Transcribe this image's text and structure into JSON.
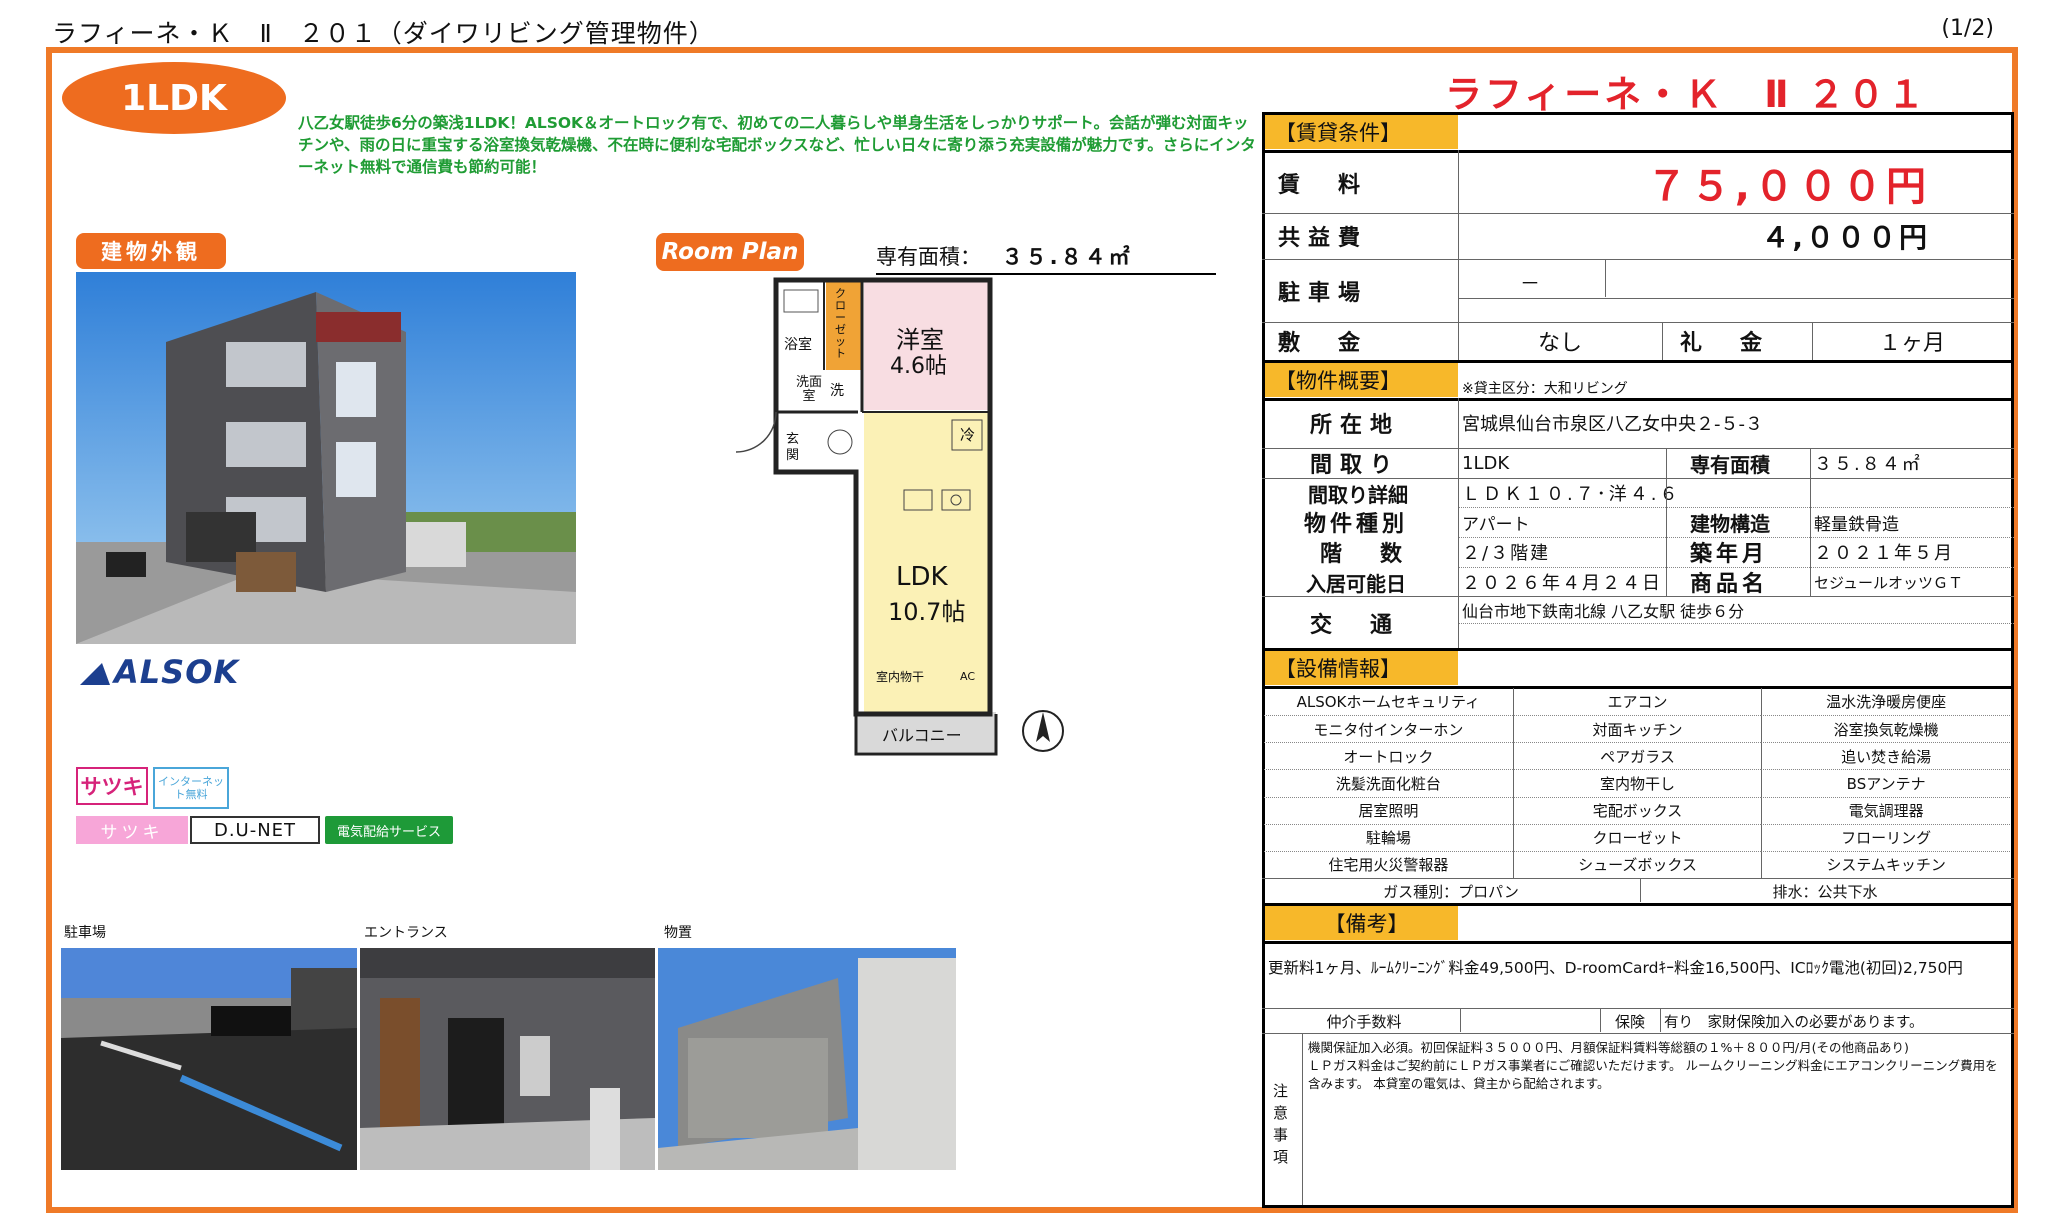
{
  "header": {
    "title": "ラフィーネ・Ｋ　Ⅱ　２０１（ダイワリビング管理物件）",
    "page": "(1/2)"
  },
  "badge_type": "1LDK",
  "description": "八乙女駅徒歩6分の築浅1LDK！ALSOK＆オートロック有で、初めての二人暮らしや単身生活をしっかりサポート。会話が弾む対面キッチンや、雨の日に重宝する浴室換気乾燥機、不在時に便利な宅配ボックスなど、忙しい日々に寄り添う充実設備が魅力です。さらにインターネット無料で通信費も節約可能！",
  "left": {
    "exterior_label": "建物外観",
    "plan_label": "Room Plan",
    "area_label": "専有面積：",
    "area_value": "３５.８４㎡",
    "alsok": "ALSOK",
    "satsuki": "サツキ",
    "inet": "インターネット無料",
    "satsuki_bar": "サツキ",
    "dunet": "D.U-NET",
    "elec": "電気配給サービス"
  },
  "floorplan": {
    "bath": "浴室",
    "closet": "クローゼット",
    "western": "洋室",
    "western_size": "4.6帖",
    "wash": "洗面室",
    "washer": "洗",
    "entrance": "玄関",
    "fridge": "冷",
    "ldk": "LDK",
    "ldk_size": "10.7帖",
    "dry": "室内物干",
    "ac": "AC",
    "balcony": "バルコニー"
  },
  "thumbs": [
    {
      "caption": "駐車場"
    },
    {
      "caption": "エントランス"
    },
    {
      "caption": "物置"
    }
  ],
  "right": {
    "prop_name": "ラフィーネ・Ｋ　Ⅱ ２０１",
    "rent_hdr": "【賃貸条件】",
    "rent_k": "賃　料",
    "rent_v": "７５,０００円",
    "common_k": "共益費",
    "common_v": "４,０００円",
    "parking_k": "駐車場",
    "parking_v": "－",
    "deposit_k": "敷　金",
    "deposit_v": "なし",
    "key_k": "礼　金",
    "key_v": "１ヶ月",
    "outline_hdr": "【物件概要】",
    "owner_note": "※貸主区分：大和リビング",
    "addr_k": "所在地",
    "addr_v": "宮城県仙台市泉区八乙女中央２-５-３",
    "layout_k": "間取り",
    "layout_v": "1LDK",
    "area_k": "専有面積",
    "area_v": "３５.８４㎡",
    "detail_k": "間取り詳細",
    "detail_v": "ＬＤＫ１０.７･洋４.６",
    "type_k": "物件種別",
    "type_v": "アパート",
    "struct_k": "建物構造",
    "struct_v": "軽量鉄骨造",
    "floors_k": "階　数",
    "floors_v": "２/３階建",
    "built_k": "築年月",
    "built_v": "２０２１年５月",
    "movein_k": "入居可能日",
    "movein_v": "２０２６年４月２４日",
    "product_k": "商品名",
    "product_v": "セジュールオッツＧＴ",
    "access_k": "交　通",
    "access_v": "仙台市地下鉄南北線 八乙女駅 徒歩６分",
    "equip_hdr": "【設備情報】",
    "equipment": [
      [
        "ALSOKホームセキュリティ",
        "エアコン",
        "温水洗浄暖房便座"
      ],
      [
        "モニタ付インターホン",
        "対面キッチン",
        "浴室換気乾燥機"
      ],
      [
        "オートロック",
        "ペアガラス",
        "追い焚き給湯"
      ],
      [
        "洗髪洗面化粧台",
        "室内物干し",
        "BSアンテナ"
      ],
      [
        "居室照明",
        "宅配ボックス",
        "電気調理器"
      ],
      [
        "駐輪場",
        "クローゼット",
        "フローリング"
      ],
      [
        "住宅用火災警報器",
        "シューズボックス",
        "システムキッチン"
      ]
    ],
    "gas": "ガス種別：プロパン",
    "drain": "排水：公共下水",
    "remarks_hdr": "【備考】",
    "remarks": "更新料1ヶ月、ﾙｰﾑｸﾘｰﾆﾝｸﾞ料金49,500円、D-roomCardｷｰ料金16,500円、ICﾛｯｸ電池(初回)2,750円",
    "broker_k": "仲介手数料",
    "insure_k": "保険",
    "insure_v": "有り　家財保険加入の必要があります。",
    "notes_k": "注意事項",
    "notes": "機関保証加入必須。初回保証料３５０００円、月額保証料賃料等総額の１%＋８００円/月(その他商品あり)\nＬＰガス料金はご契約前にＬＰガス事業者にご確認いただけます。 ルームクリーニング料金にエアコンクリーニング費用を含みます。 本貸室の電気は、貸主から配給されます。"
  }
}
